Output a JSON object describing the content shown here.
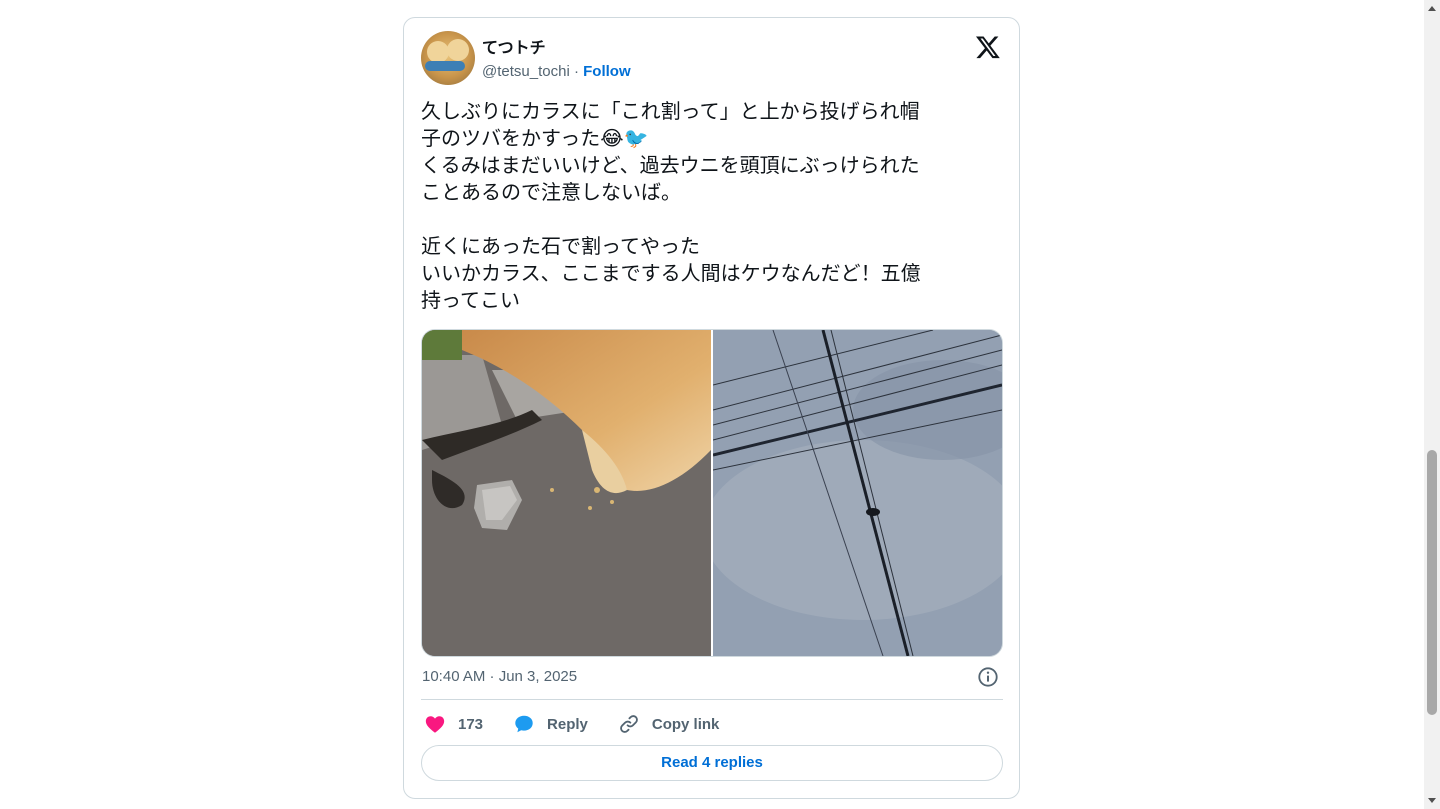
{
  "tweet": {
    "display_name": "てつトチ",
    "handle": "@tetsu_tochi",
    "separator": "·",
    "follow_label": "Follow",
    "text": "久しぶりにカラスに「これ割って」と上から投げられ帽\n子のツバをかすった😂🐦\nくるみはまだいいけど、過去ウニを頭頂にぶっけられた\nことあるので注意しないば。\n\n近くにあった石で割ってやった\nいいかカラス、ここまでする人間はケウなんだど！五億\n持ってこい",
    "timestamp": "10:40 AM · Jun 3, 2025",
    "like_count": "173",
    "reply_label": "Reply",
    "copy_link_label": "Copy link",
    "read_replies_label": "Read 4 replies"
  },
  "icons": {
    "logo": "x-logo-icon",
    "info": "info-icon",
    "like": "heart-icon",
    "reply": "speech-bubble-icon",
    "copy": "link-icon"
  },
  "colors": {
    "follow": "#006fd6",
    "heart": "#f91880",
    "reply": "#1d9bf0",
    "border": "#cfd9de"
  }
}
